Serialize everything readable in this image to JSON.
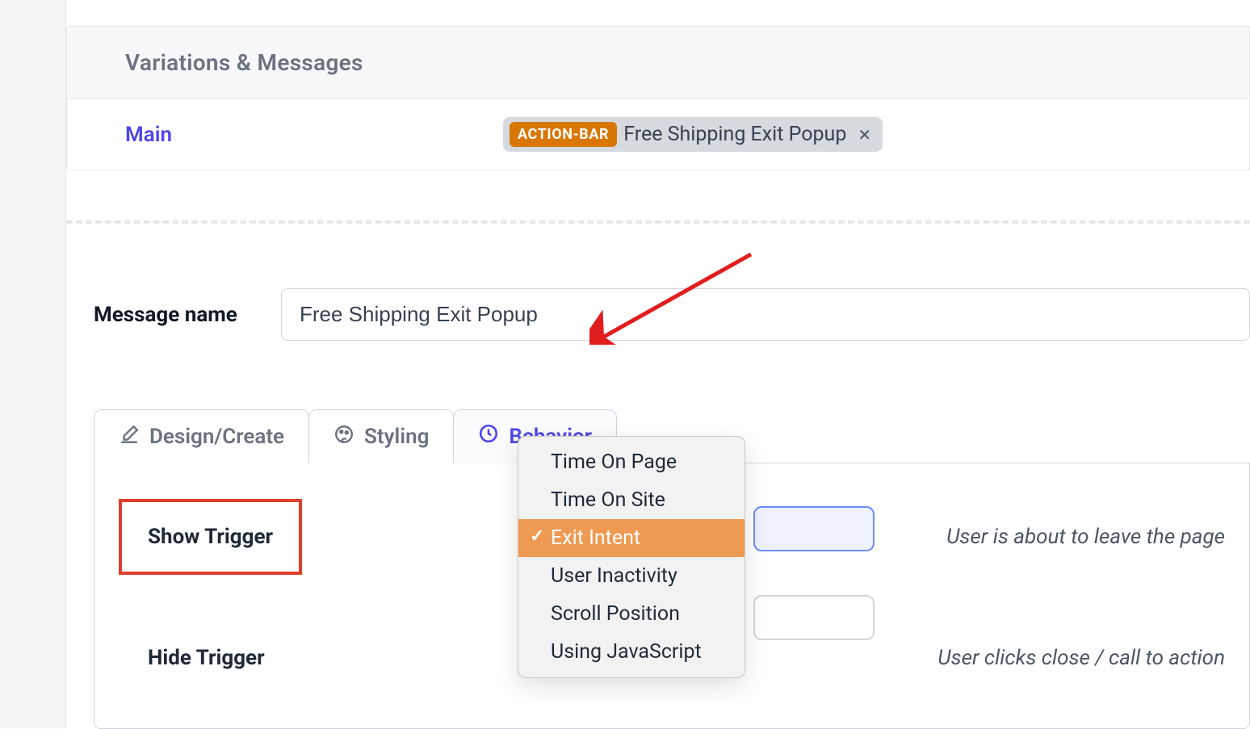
{
  "variations": {
    "header": "Variations & Messages",
    "main_link": "Main",
    "chip_badge": "ACTION-BAR",
    "chip_text": "Free Shipping Exit Popup"
  },
  "form": {
    "message_name_label": "Message name",
    "message_name_value": "Free Shipping Exit Popup"
  },
  "tabs": {
    "design": "Design/Create",
    "styling": "Styling",
    "behavior": "Behavior"
  },
  "panel": {
    "show_trigger_label": "Show Trigger",
    "show_trigger_desc": "User is about to leave the page",
    "hide_trigger_label": "Hide Trigger",
    "hide_trigger_desc": "User clicks close / call to action"
  },
  "dropdown": {
    "items": [
      "Time On Page",
      "Time On Site",
      "Exit Intent",
      "User Inactivity",
      "Scroll Position",
      "Using JavaScript"
    ],
    "selected_index": 2
  }
}
